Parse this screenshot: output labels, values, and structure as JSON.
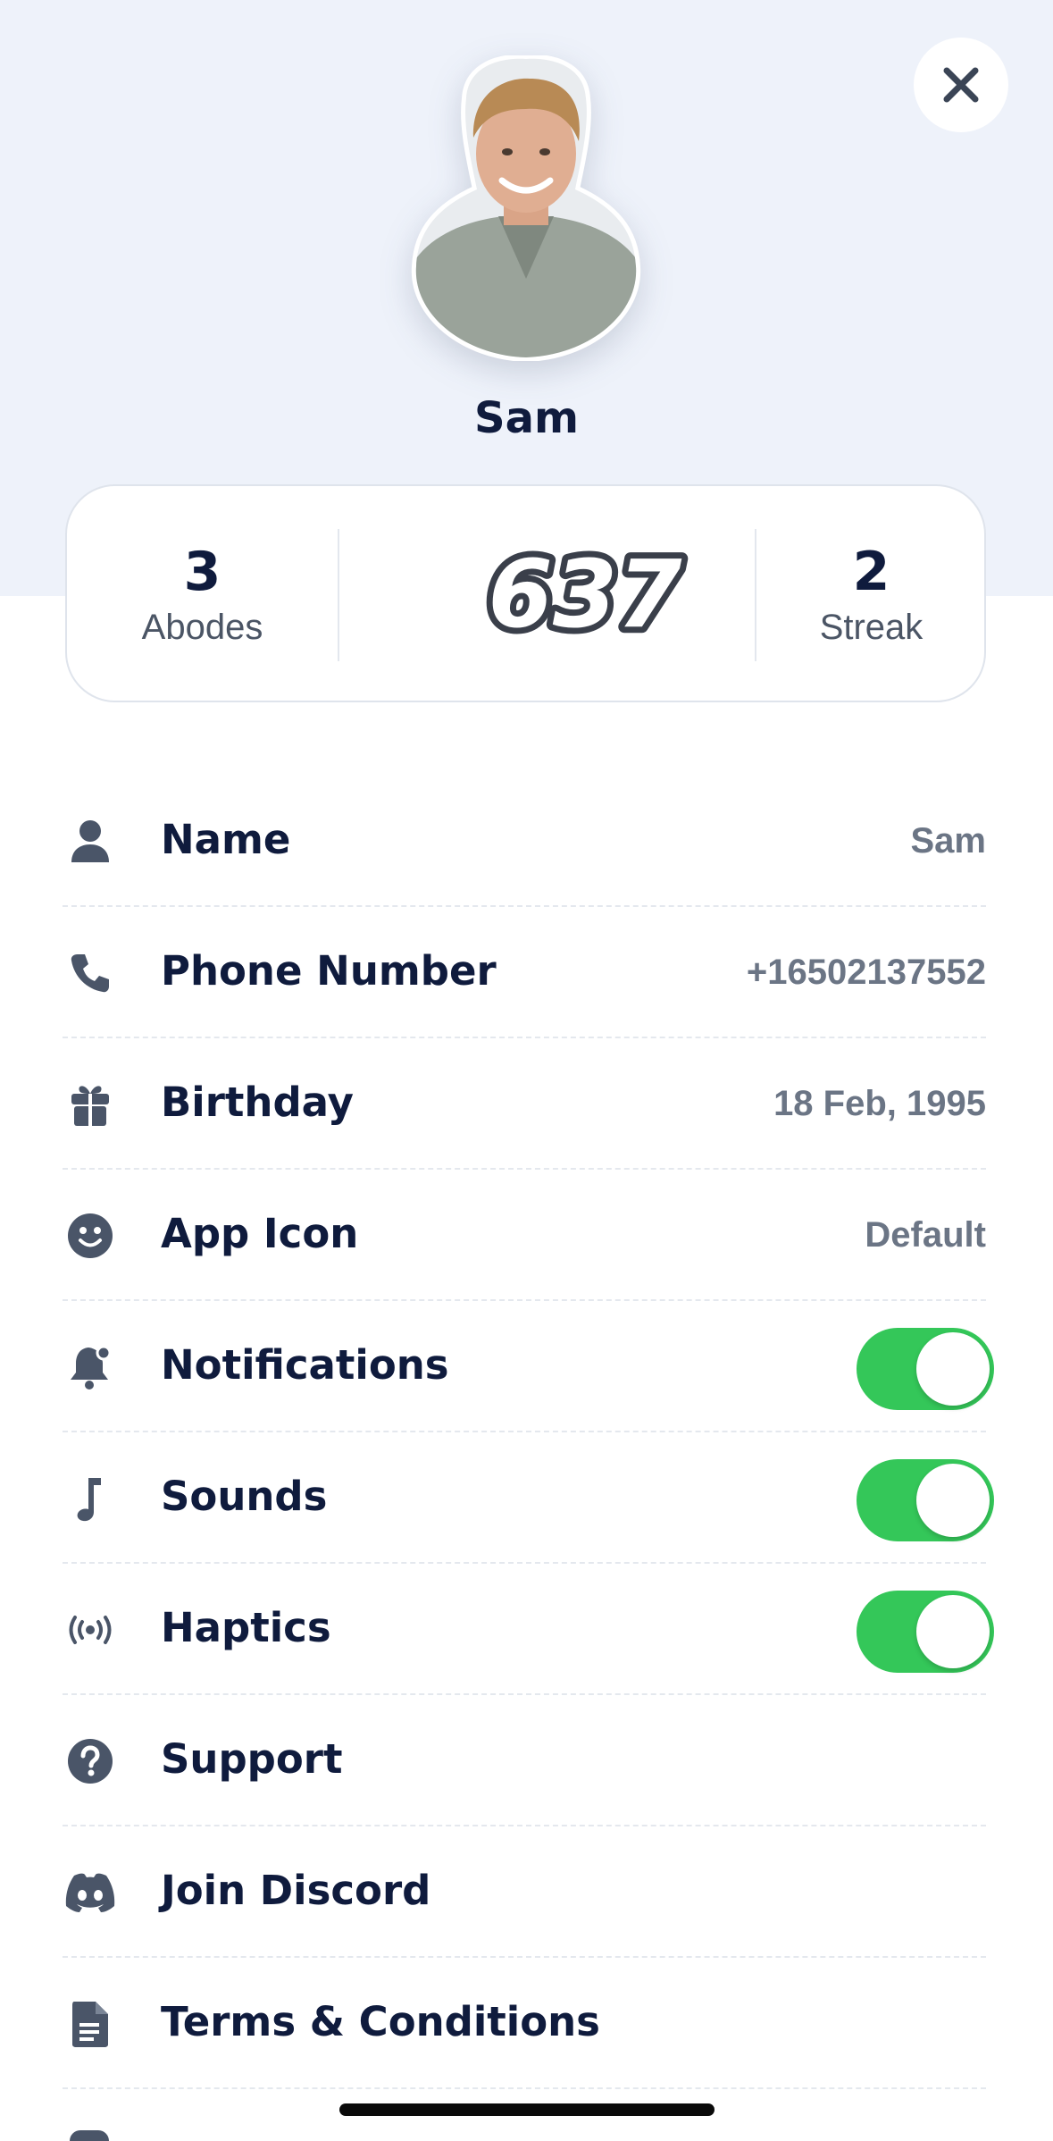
{
  "profile": {
    "name": "Sam",
    "avatar_alt": "profile-photo"
  },
  "stats": {
    "abodes": {
      "value": "3",
      "label": "Abodes"
    },
    "score": "637",
    "streak": {
      "value": "2",
      "label": "Streak"
    }
  },
  "settings": [
    {
      "label": "Name",
      "value": "Sam",
      "icon": "person-icon"
    },
    {
      "label": "Phone Number",
      "value": "+16502137552",
      "icon": "phone-icon"
    },
    {
      "label": "Birthday",
      "value": "18 Feb, 1995",
      "icon": "gift-icon"
    },
    {
      "label": "App Icon",
      "value": "Default",
      "icon": "smiley-icon"
    },
    {
      "label": "Notifications",
      "toggle_on": true,
      "icon": "bell-icon"
    },
    {
      "label": "Sounds",
      "toggle_on": true,
      "icon": "music-note-icon"
    },
    {
      "label": "Haptics",
      "toggle_on": true,
      "icon": "haptics-icon"
    },
    {
      "label": "Support",
      "icon": "question-icon"
    },
    {
      "label": "Join Discord",
      "icon": "discord-icon"
    },
    {
      "label": "Terms & Conditions",
      "icon": "document-icon"
    }
  ],
  "colors": {
    "header_background": "#eef2fa",
    "toggle_on": "#34c759",
    "primary_text": "#0f1b3d",
    "secondary_text": "#6b7585"
  }
}
